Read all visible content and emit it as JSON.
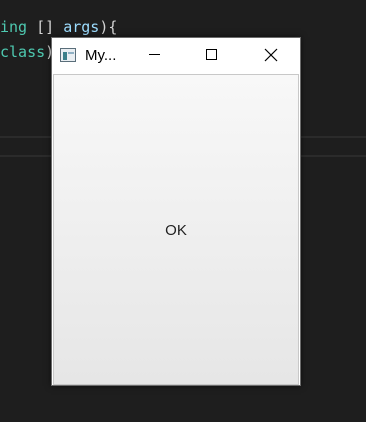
{
  "editor": {
    "line1": {
      "type": "ing",
      "brackets": " [] ",
      "var": "args",
      "tail": "){"
    },
    "line2": {
      "kw": "class",
      "tail": ")"
    }
  },
  "window": {
    "title": "My...",
    "icon": "java-window-icon",
    "controls": {
      "minimize": "minimize-icon",
      "maximize": "maximize-icon",
      "close": "close-icon"
    },
    "button_label": "OK"
  },
  "colors": {
    "editor_bg": "#1e1e1e",
    "type": "#4ec9b0",
    "variable": "#9cdcfe",
    "keyword": "#569cd6"
  }
}
